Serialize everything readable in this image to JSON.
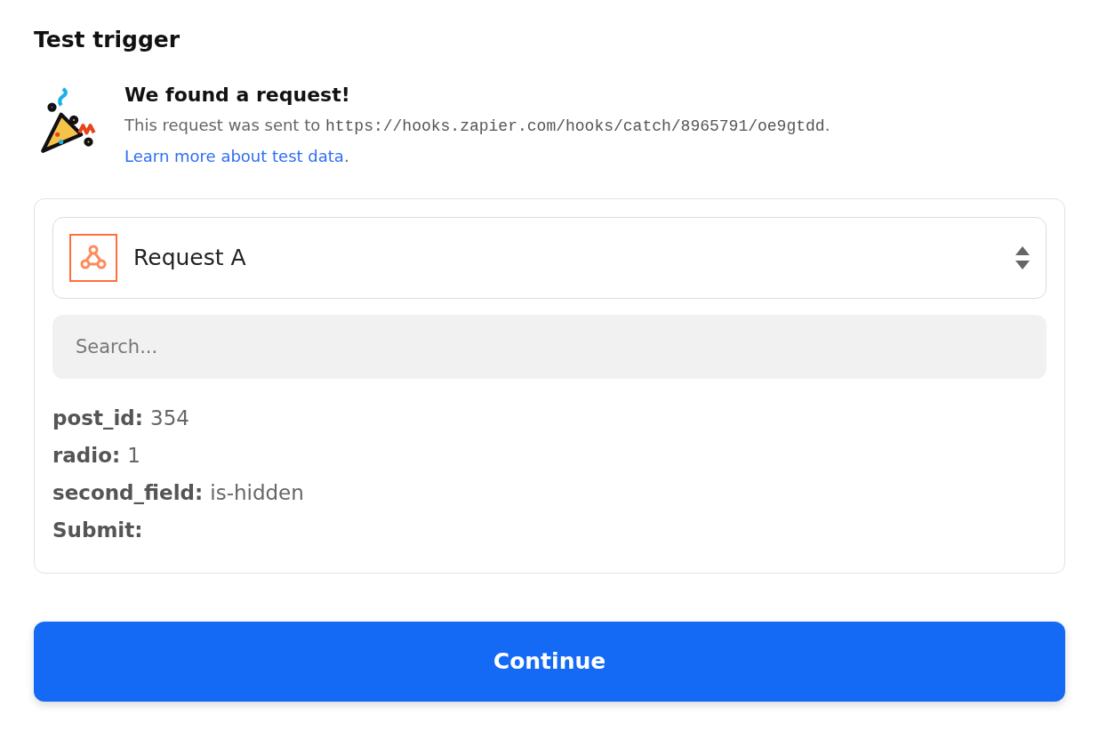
{
  "heading": "Test trigger",
  "notice": {
    "title": "We found a request!",
    "text_before": "This request was sent to ",
    "url": "https://hooks.zapier.com/hooks/catch/8965791/oe9gtdd",
    "text_after": ".",
    "link": "Learn more about test data",
    "link_after": "."
  },
  "request_select": {
    "value": "Request A"
  },
  "search": {
    "placeholder": "Search..."
  },
  "fields": [
    {
      "key": "post_id:",
      "value": "354"
    },
    {
      "key": "radio:",
      "value": "1"
    },
    {
      "key": "second_field:",
      "value": "is-hidden"
    },
    {
      "key": "Submit:"
    }
  ],
  "continue_button": "Continue"
}
